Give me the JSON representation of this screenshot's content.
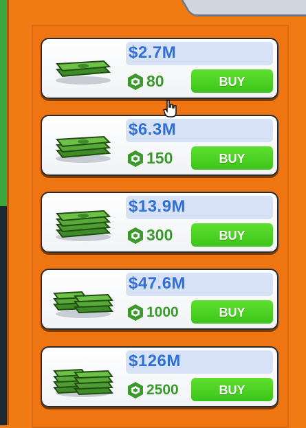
{
  "items": [
    {
      "price": "$2.7M",
      "cost": "80",
      "buy_label": "BUY"
    },
    {
      "price": "$6.3M",
      "cost": "150",
      "buy_label": "BUY"
    },
    {
      "price": "$13.9M",
      "cost": "300",
      "buy_label": "BUY"
    },
    {
      "price": "$47.6M",
      "cost": "1000",
      "buy_label": "BUY"
    },
    {
      "price": "$126M",
      "cost": "2500",
      "buy_label": "BUY"
    }
  ],
  "colors": {
    "accent_orange": "#f07a14",
    "price_blue": "#2f6fd8",
    "buy_green": "#3cc31a",
    "cost_green": "#3a9a2c"
  }
}
